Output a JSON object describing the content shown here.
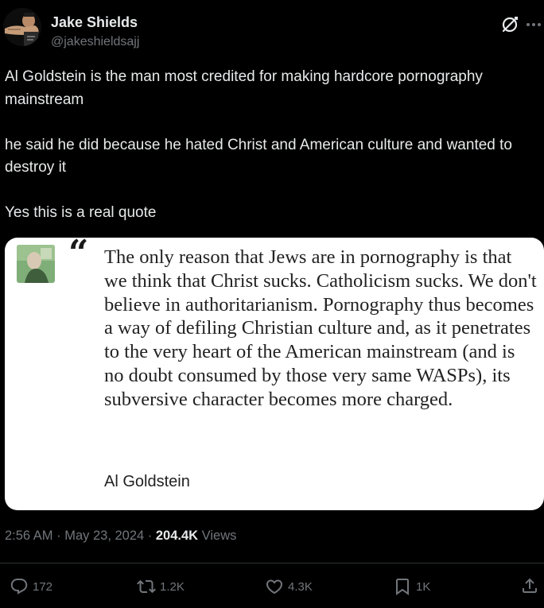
{
  "author": {
    "name": "Jake Shields",
    "handle": "@jakeshieldsajj"
  },
  "icons": {
    "grok": "grok-icon",
    "more": "more-icon",
    "reply": "reply-icon",
    "repost": "repost-icon",
    "like": "heart-icon",
    "bookmark": "bookmark-icon",
    "share": "share-icon"
  },
  "tweet": {
    "paragraphs": [
      "Al Goldstein is the man most credited for making hardcore pornography mainstream",
      "he said he did because he hated Christ and American culture and wanted to destroy it",
      "Yes this is a real quote"
    ]
  },
  "media": {
    "quote_mark": "“",
    "quote_text": "The only reason that Jews are in pornography is that we think that Christ sucks. Catholicism sucks. We don't believe in authoritarianism. Pornography thus becomes a way of defiling Christian culture and, as it penetrates to the very heart of the American mainstream (and is no doubt consumed by those very same WASPs), its subversive character becomes more charged.",
    "quote_author": "Al Goldstein"
  },
  "meta": {
    "time": "2:56 AM",
    "separator": " · ",
    "date": "May 23, 2024",
    "views_count": "204.4K",
    "views_label": " Views"
  },
  "actions": {
    "replies": "172",
    "reposts": "1.2K",
    "likes": "4.3K",
    "bookmarks": "1K"
  },
  "colors": {
    "background": "#000000",
    "text_primary": "#e7e9ea",
    "text_secondary": "#71767b",
    "divider": "#2f3336",
    "card_background": "#ffffff"
  }
}
